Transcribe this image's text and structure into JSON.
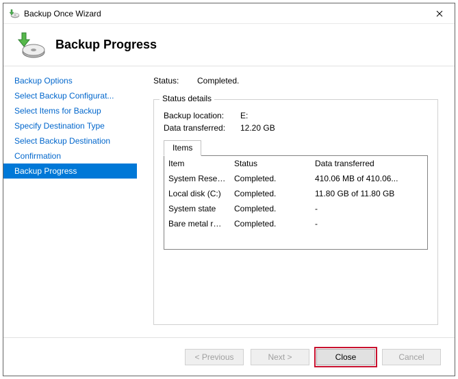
{
  "window": {
    "title": "Backup Once Wizard"
  },
  "header": {
    "title": "Backup Progress"
  },
  "sidebar": {
    "steps": [
      {
        "label": "Backup Options",
        "selected": false
      },
      {
        "label": "Select Backup Configurat...",
        "selected": false
      },
      {
        "label": "Select Items for Backup",
        "selected": false
      },
      {
        "label": "Specify Destination Type",
        "selected": false
      },
      {
        "label": "Select Backup Destination",
        "selected": false
      },
      {
        "label": "Confirmation",
        "selected": false
      },
      {
        "label": "Backup Progress",
        "selected": true
      }
    ]
  },
  "main": {
    "status_label": "Status:",
    "status_value": "Completed.",
    "details_legend": "Status details",
    "location_label": "Backup location:",
    "location_value": "E:",
    "transferred_label": "Data transferred:",
    "transferred_value": "12.20 GB",
    "tab_label": "Items",
    "columns": {
      "c0": "Item",
      "c1": "Status",
      "c2": "Data transferred"
    },
    "rows": [
      {
        "item": "System Reserv...",
        "status": "Completed.",
        "xfer": "410.06 MB of 410.06..."
      },
      {
        "item": "Local disk (C:)",
        "status": "Completed.",
        "xfer": "11.80 GB of 11.80 GB"
      },
      {
        "item": "System state",
        "status": "Completed.",
        "xfer": "-"
      },
      {
        "item": "Bare metal rec...",
        "status": "Completed.",
        "xfer": "-"
      }
    ]
  },
  "footer": {
    "prev": "< Previous",
    "next": "Next >",
    "close": "Close",
    "cancel": "Cancel"
  }
}
